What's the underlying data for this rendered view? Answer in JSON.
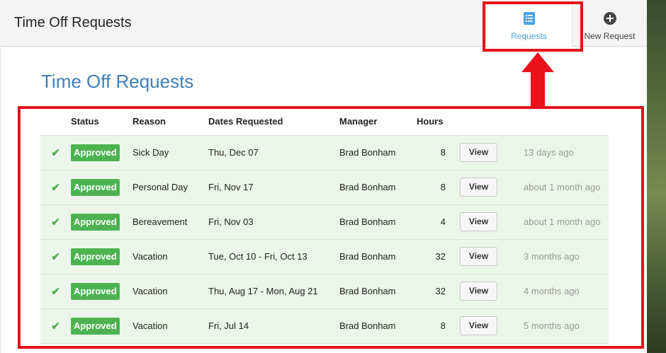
{
  "header": {
    "title": "Time Off Requests",
    "tabs": [
      {
        "label": "Requests",
        "icon": "list-document-icon",
        "active": true
      },
      {
        "label": "New Request",
        "icon": "plus-circle-icon",
        "active": false
      }
    ]
  },
  "main": {
    "title": "Time Off Requests",
    "columns": [
      "",
      "Status",
      "Reason",
      "Dates Requested",
      "Manager",
      "Hours",
      "",
      ""
    ],
    "rows": [
      {
        "status": "Approved",
        "reason": "Sick Day",
        "dates": "Thu, Dec 07",
        "manager": "Brad Bonham",
        "hours": "8",
        "action": "View",
        "ago": "13 days ago"
      },
      {
        "status": "Approved",
        "reason": "Personal Day",
        "dates": "Fri, Nov 17",
        "manager": "Brad Bonham",
        "hours": "8",
        "action": "View",
        "ago": "about 1 month ago"
      },
      {
        "status": "Approved",
        "reason": "Bereavement",
        "dates": "Fri, Nov 03",
        "manager": "Brad Bonham",
        "hours": "4",
        "action": "View",
        "ago": "about 1 month ago"
      },
      {
        "status": "Approved",
        "reason": "Vacation",
        "dates": "Tue, Oct 10 - Fri, Oct 13",
        "manager": "Brad Bonham",
        "hours": "32",
        "action": "View",
        "ago": "3 months ago"
      },
      {
        "status": "Approved",
        "reason": "Vacation",
        "dates": "Thu, Aug 17 - Mon, Aug 21",
        "manager": "Brad Bonham",
        "hours": "32",
        "action": "View",
        "ago": "4 months ago"
      },
      {
        "status": "Approved",
        "reason": "Vacation",
        "dates": "Fri, Jul 14",
        "manager": "Brad Bonham",
        "hours": "8",
        "action": "View",
        "ago": "5 months ago"
      }
    ]
  },
  "colors": {
    "accent": "#4aa3df",
    "title_blue": "#3f7fb7",
    "approved_green": "#4cb350",
    "row_bg": "#ecf5ea",
    "annotation_red": "#e8111c"
  }
}
